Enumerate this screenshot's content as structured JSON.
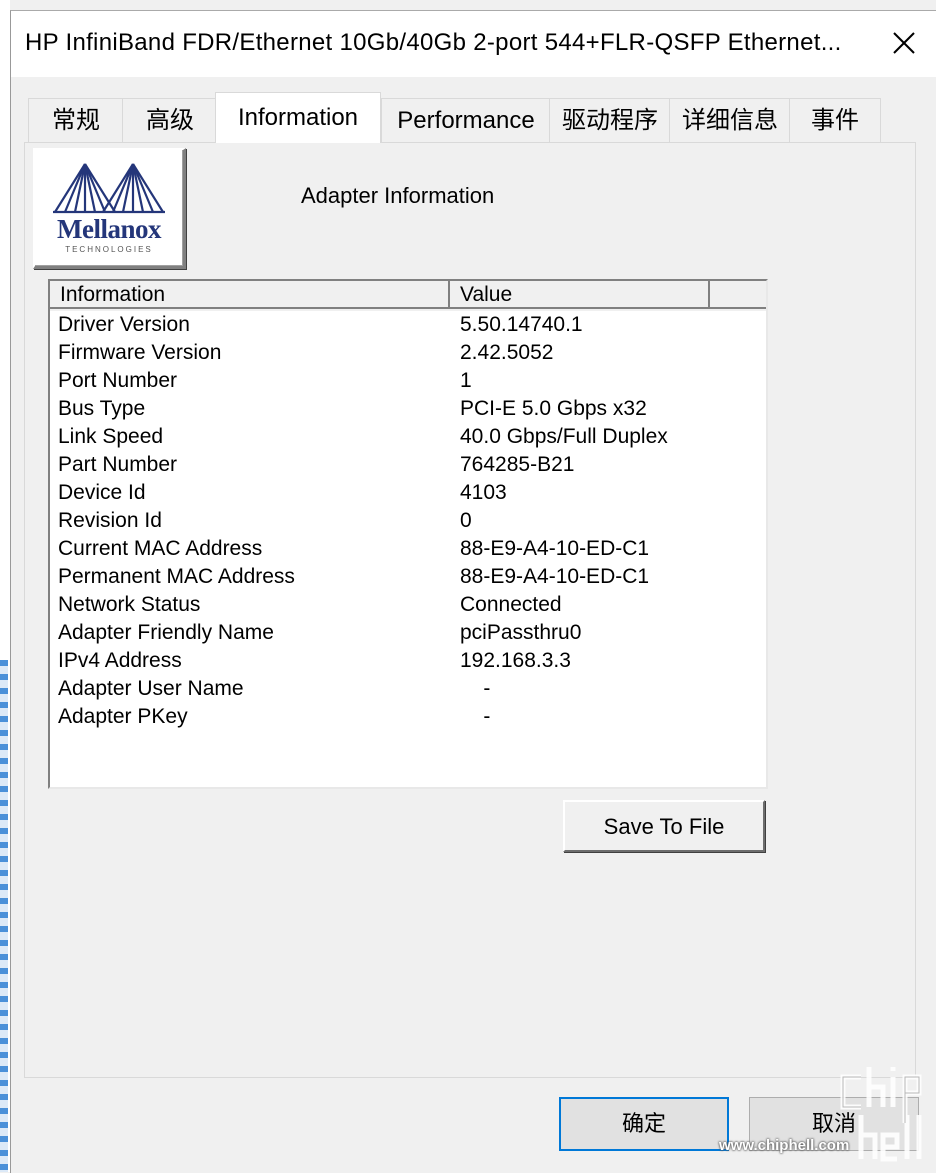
{
  "window": {
    "title": "HP InfiniBand FDR/Ethernet 10Gb/40Gb 2-port 544+FLR-QSFP Ethernet...",
    "close_icon": "close-icon"
  },
  "tabs": [
    {
      "label": "常规"
    },
    {
      "label": "高级"
    },
    {
      "label": "Information",
      "active": true
    },
    {
      "label": "Performance"
    },
    {
      "label": "驱动程序"
    },
    {
      "label": "详细信息"
    },
    {
      "label": "事件"
    }
  ],
  "logo": {
    "name": "Mellanox",
    "sub": "TECHNOLOGIES",
    "color": "#24367a"
  },
  "section_title": "Adapter Information",
  "table": {
    "columns": [
      "Information",
      "Value"
    ],
    "rows": [
      {
        "name": "Driver Version",
        "value": "5.50.14740.1"
      },
      {
        "name": "Firmware Version",
        "value": "2.42.5052"
      },
      {
        "name": "Port Number",
        "value": "1"
      },
      {
        "name": "Bus Type",
        "value": "PCI-E 5.0 Gbps x32"
      },
      {
        "name": "Link Speed",
        "value": "40.0 Gbps/Full Duplex"
      },
      {
        "name": "Part Number",
        "value": "764285-B21"
      },
      {
        "name": "Device Id",
        "value": "4103"
      },
      {
        "name": "Revision Id",
        "value": "0"
      },
      {
        "name": "Current MAC Address",
        "value": "88-E9-A4-10-ED-C1"
      },
      {
        "name": "Permanent MAC Address",
        "value": "88-E9-A4-10-ED-C1"
      },
      {
        "name": "Network Status",
        "value": "Connected"
      },
      {
        "name": "Adapter Friendly Name",
        "value": "pciPassthru0"
      },
      {
        "name": "IPv4 Address",
        "value": "192.168.3.3"
      },
      {
        "name": "Adapter User Name",
        "value": "    -"
      },
      {
        "name": "Adapter PKey",
        "value": "    -"
      }
    ]
  },
  "save_button": "Save To File",
  "ok_button": "确定",
  "cancel_button": "取消",
  "watermark": "www.chiphell.com",
  "colors": {
    "accent": "#0078d7",
    "window_bg": "#f0f0f0"
  }
}
